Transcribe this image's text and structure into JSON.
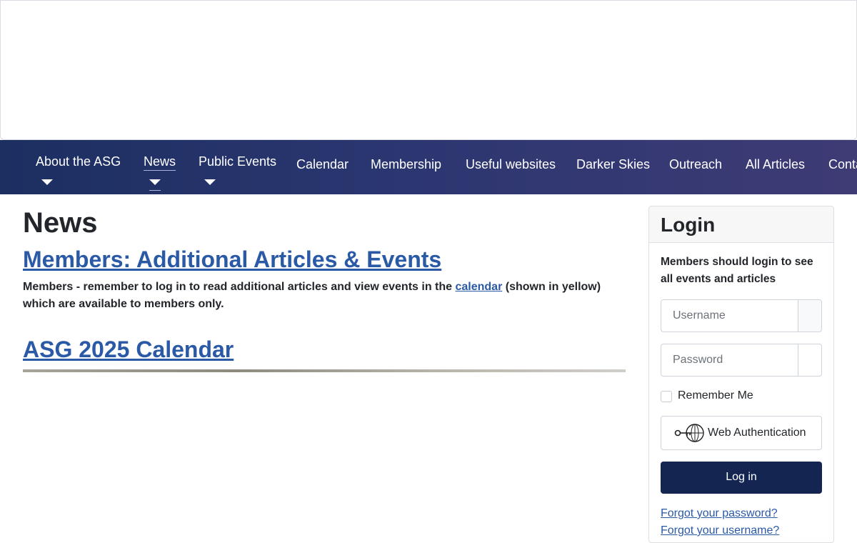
{
  "nav": {
    "items": [
      {
        "label": "About the ASG",
        "dropdown": true
      },
      {
        "label": "News",
        "dropdown": true,
        "active": true
      },
      {
        "label": "Public Events",
        "dropdown": true
      },
      {
        "label": "Calendar",
        "dropdown": false
      },
      {
        "label": "Membership",
        "dropdown": false
      },
      {
        "label": "Useful websites",
        "dropdown": false
      },
      {
        "label": "Darker Skies",
        "dropdown": false
      },
      {
        "label": "Outreach",
        "dropdown": false
      },
      {
        "label": "All Articles",
        "dropdown": false
      },
      {
        "label": "Contact",
        "dropdown": false
      }
    ]
  },
  "main": {
    "page_title": "News",
    "articles": [
      {
        "title": "Members: Additional Articles & Events",
        "intro_before": "Members - remember to log in to read additional articles and view events in the ",
        "intro_link": "calendar",
        "intro_after": " (shown in yellow) which are available to members only."
      },
      {
        "title": "ASG 2025 Calendar"
      }
    ]
  },
  "login": {
    "title": "Login",
    "message": "Members should login to see all events and articles",
    "username_placeholder": "Username",
    "password_placeholder": "Password",
    "remember_label": "Remember Me",
    "webauthn_label": "Web Authentication",
    "submit_label": "Log in",
    "forgot_password": "Forgot your password?",
    "forgot_username": "Forgot your username?"
  },
  "colors": {
    "nav_start": "#1c2f61",
    "nav_end": "#3e3b75",
    "link": "#2a59a6",
    "button": "#142552"
  }
}
